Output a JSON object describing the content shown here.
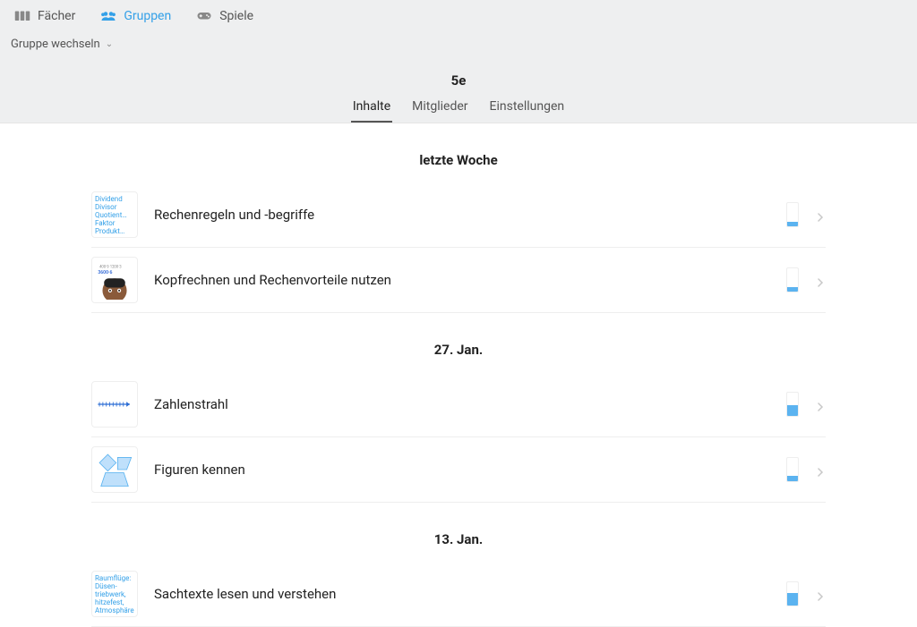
{
  "nav": {
    "items": [
      {
        "label": "Fächer",
        "icon": "columns-icon"
      },
      {
        "label": "Gruppen",
        "icon": "users-icon"
      },
      {
        "label": "Spiele",
        "icon": "gamepad-icon"
      }
    ],
    "active_index": 1,
    "group_switch_label": "Gruppe wechseln"
  },
  "group": {
    "title": "5e",
    "tabs": [
      {
        "label": "Inhalte"
      },
      {
        "label": "Mitglieder"
      },
      {
        "label": "Einstellungen"
      }
    ],
    "active_tab": 0
  },
  "sections": [
    {
      "heading": "letzte Woche",
      "items": [
        {
          "title": "Rechenregeln und -begriffe",
          "thumb_text": "Dividend Divisor Quotient… Faktor Produkt…",
          "progress_pct": 20
        },
        {
          "title": "Kopfrechnen und Rechenvorteile nutzen",
          "thumb_svg": "kopfrechnen",
          "progress_pct": 20
        }
      ]
    },
    {
      "heading": "27. Jan.",
      "items": [
        {
          "title": "Zahlenstrahl",
          "thumb_svg": "numberline",
          "progress_pct": 45
        },
        {
          "title": "Figuren kennen",
          "thumb_svg": "shapes",
          "progress_pct": 25
        }
      ]
    },
    {
      "heading": "13. Jan.",
      "items": [
        {
          "title": "Sachtexte lesen und verstehen",
          "thumb_text": "Raumflüge: Düsen-triebwerk, hitzefest, Atmosphäre",
          "progress_pct": 55
        }
      ]
    }
  ]
}
